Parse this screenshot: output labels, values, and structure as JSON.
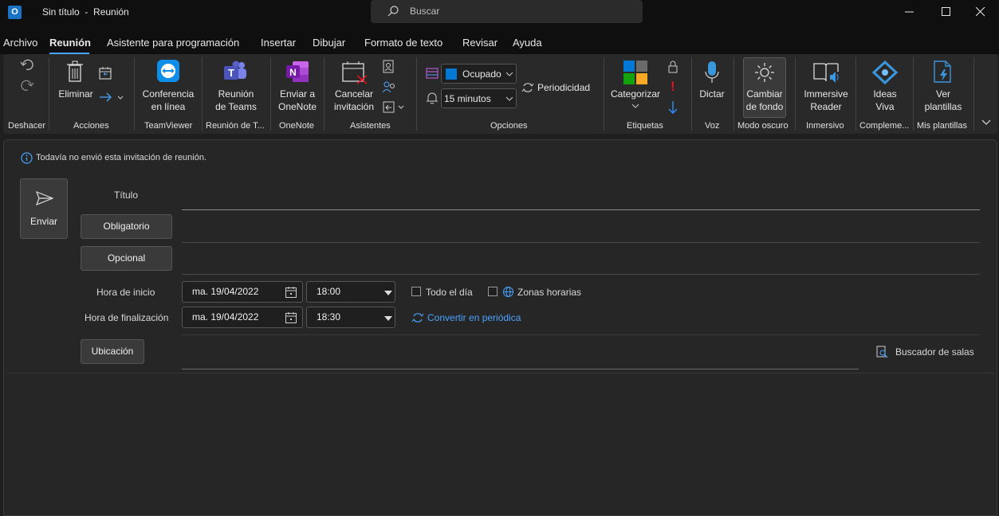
{
  "window": {
    "app_icon_letter": "O",
    "title": "Sin título  -  Reunión",
    "search_placeholder": "Buscar"
  },
  "tabs": [
    "Archivo",
    "Reunión",
    "Asistente para programación",
    "Insertar",
    "Dibujar",
    "Formato de texto",
    "Revisar",
    "Ayuda"
  ],
  "active_tab": "Reunión",
  "ribbon": {
    "groups": {
      "undo": "Deshacer",
      "actions": "Acciones",
      "teamviewer": "TeamViewer",
      "teams": "Reunión de T...",
      "onenote": "OneNote",
      "attendees": "Asistentes",
      "options": "Opciones",
      "tags": "Etiquetas",
      "voice": "Voz",
      "dark_mode": "Modo oscuro",
      "immersive": "Inmersivo",
      "addins": "Compleme...",
      "templates": "Mis plantillas"
    },
    "buttons": {
      "delete": "Eliminar",
      "online_meeting": "Conferencia\nen línea",
      "teams_meeting": "Reunión\nde Teams",
      "send_onenote": "Enviar a\nOneNote",
      "cancel_invite": "Cancelar\ninvitación",
      "show_as_value": "Ocupado",
      "reminder_value": "15 minutos",
      "recurrence": "Periodicidad",
      "categorize": "Categorizar",
      "dictate": "Dictar",
      "change_background": "Cambiar\nde fondo",
      "immersive_reader": "Immersive\nReader",
      "ideas": "Ideas\nViva",
      "view_templates": "Ver\nplantillas"
    },
    "colors": {
      "busy": "#0078d4",
      "teamviewer": "#0e8ee9",
      "teams": "#5b5fc7",
      "onenote": "#7719aa",
      "importance_high": "#e81123",
      "importance_low": "#2f8fff"
    }
  },
  "form": {
    "info": "Todavía no envió esta invitación de reunión.",
    "send": "Enviar",
    "title_label": "Título",
    "required": "Obligatorio",
    "optional": "Opcional",
    "start_label": "Hora de inicio",
    "end_label": "Hora de finalización",
    "start_date": "ma. 19/04/2022",
    "start_time": "18:00",
    "end_date": "ma. 19/04/2022",
    "end_time": "18:30",
    "all_day": "Todo el día",
    "time_zones": "Zonas horarias",
    "make_recurring": "Convertir en periódica",
    "location": "Ubicación",
    "room_finder": "Buscador de salas"
  }
}
